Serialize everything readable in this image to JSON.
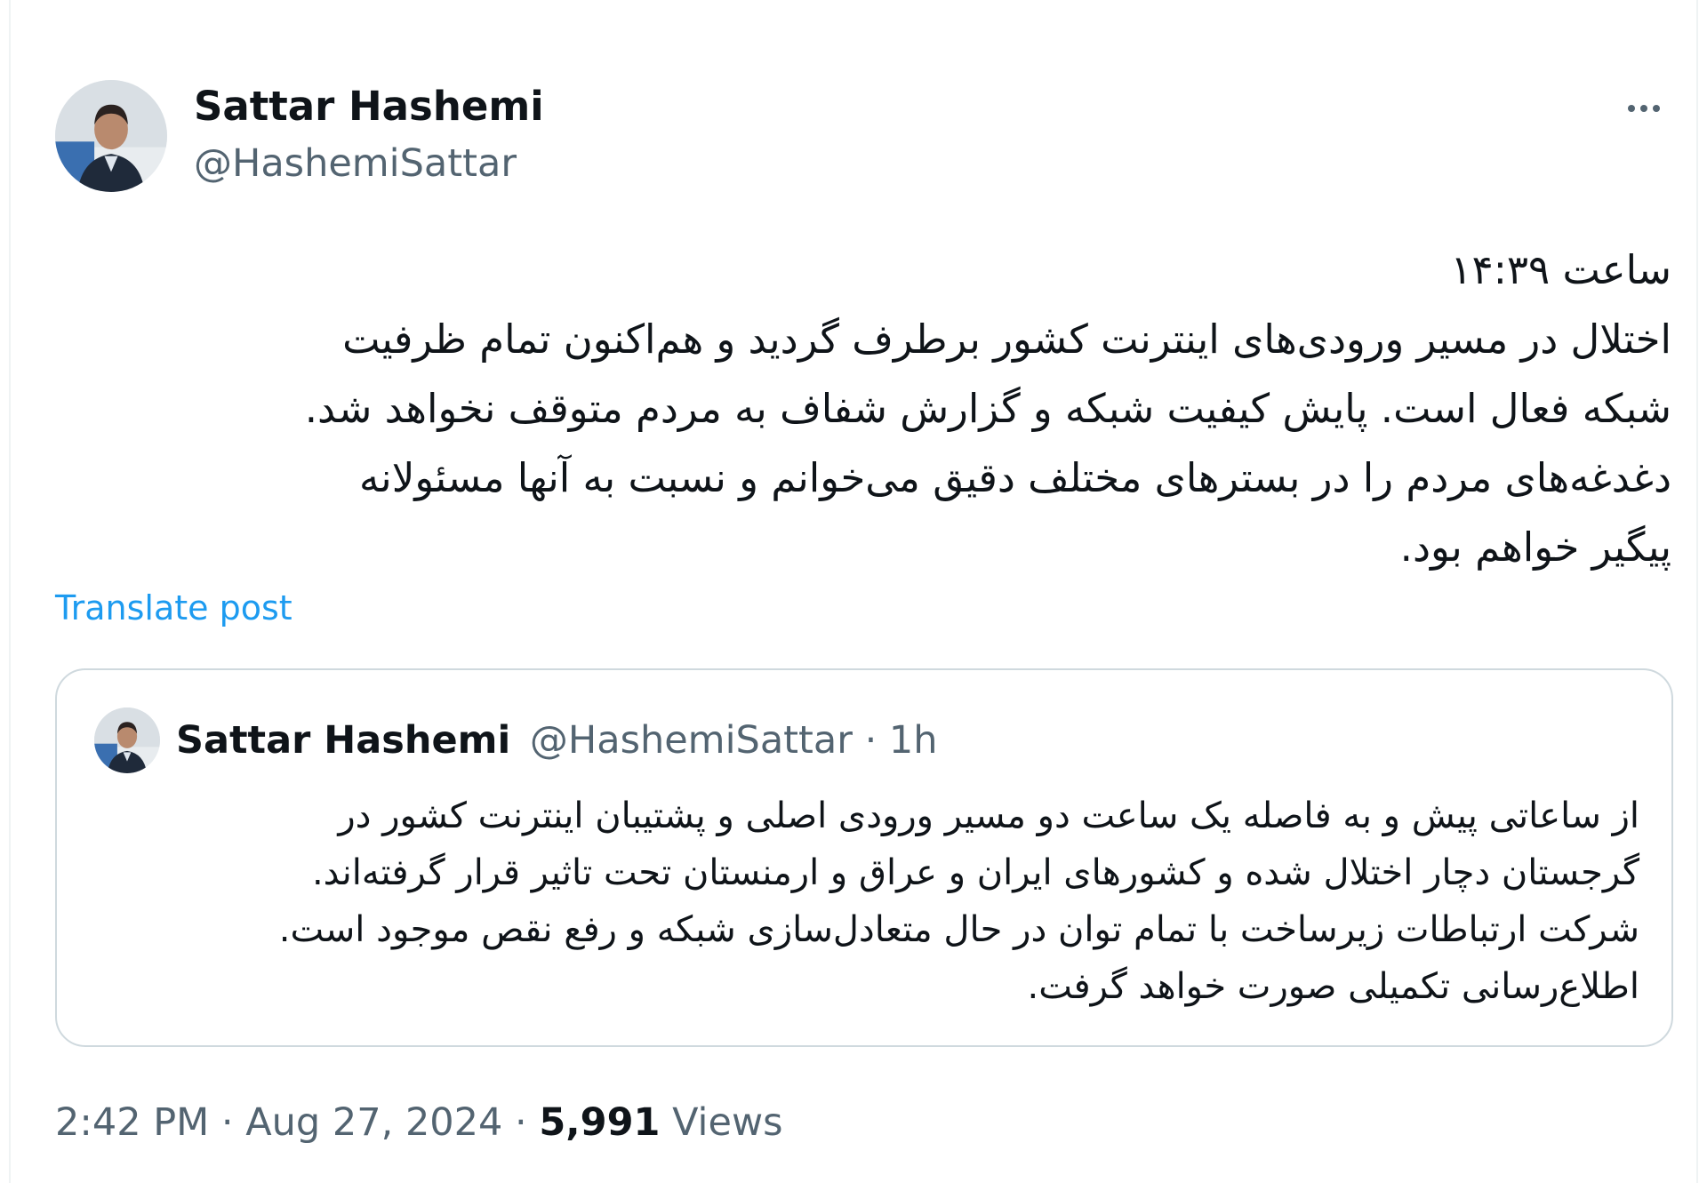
{
  "author": {
    "name": "Sattar Hashemi",
    "handle": "@HashemiSattar"
  },
  "tweet": {
    "lines": [
      "ساعت ۱۴:۳۹",
      "اختلال در مسیر ورودی‌های اینترنت کشور برطرف گردید و هم‌اکنون تمام ظرفیت",
      "شبکه فعال است. پایش کیفیت شبکه و گزارش شفاف به مردم متوقف نخواهد شد.",
      "دغدغه‌های مردم را در بسترهای مختلف دقیق می‌خوانم و نسبت به آنها مسئولانه",
      "پیگیر خواهم بود."
    ],
    "translate_label": "Translate post"
  },
  "quote": {
    "name": "Sattar Hashemi",
    "handle_time": "@HashemiSattar · 1h",
    "lines": [
      "از ساعاتی پیش و به فاصله یک ساعت دو مسیر ورودی اصلی و پشتیبان اینترنت کشور در",
      "گرجستان دچار اختلال شده و کشورهای ایران و عراق و ارمنستان تحت تاثیر قرار گرفته‌اند.",
      "شرکت ارتباطات زیرساخت با تمام توان در حال متعادل‌سازی شبکه و رفع نقص موجود است.",
      "اطلاع‌رسانی تکمیلی صورت خواهد گرفت."
    ]
  },
  "meta": {
    "time_date": "2:42 PM · Aug 27, 2024 · ",
    "views_count": "5,991",
    "views_label": " Views"
  },
  "icons": {
    "more": "more-horizontal-icon",
    "avatar": "profile-photo"
  },
  "colors": {
    "link": "#1d9bf0",
    "secondary_text": "#536471",
    "border": "#cfd9de"
  }
}
